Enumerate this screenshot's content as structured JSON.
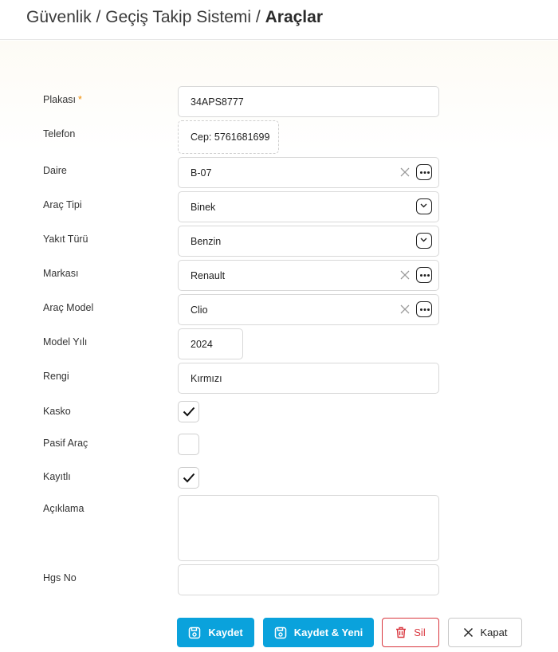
{
  "breadcrumb": {
    "part1": "Güvenlik",
    "sep": "/",
    "part2": "Geçiş Takip Sistemi",
    "current": "Araçlar"
  },
  "form": {
    "plaka": {
      "label": "Plakası",
      "required_mark": "*",
      "value": "34APS8777"
    },
    "telefon": {
      "label": "Telefon",
      "value": "Cep: 5761681699"
    },
    "daire": {
      "label": "Daire",
      "value": "B-07"
    },
    "arac_tipi": {
      "label": "Araç Tipi",
      "value": "Binek"
    },
    "yakit_turu": {
      "label": "Yakıt Türü",
      "value": "Benzin"
    },
    "markasi": {
      "label": "Markası",
      "value": "Renault"
    },
    "arac_model": {
      "label": "Araç Model",
      "value": "Clio"
    },
    "model_yili": {
      "label": "Model Yılı",
      "value": "2024"
    },
    "rengi": {
      "label": "Rengi",
      "value": "Kırmızı"
    },
    "kasko": {
      "label": "Kasko",
      "checked": true
    },
    "pasif_arac": {
      "label": "Pasif Araç",
      "checked": false
    },
    "kayitli": {
      "label": "Kayıtlı",
      "checked": true
    },
    "aciklama": {
      "label": "Açıklama",
      "value": ""
    },
    "hgs_no": {
      "label": "Hgs No",
      "value": ""
    }
  },
  "buttons": {
    "save": "Kaydet",
    "save_new": "Kaydet & Yeni",
    "delete": "Sil",
    "close": "Kapat"
  },
  "colors": {
    "primary": "#0aa2dc",
    "danger": "#d9363e",
    "required": "#f08c00"
  },
  "icons": [
    "clear-x-icon",
    "more-dots-icon",
    "chevron-down-icon",
    "checkmark-icon",
    "save-disk-icon",
    "trash-icon",
    "close-x-icon"
  ]
}
